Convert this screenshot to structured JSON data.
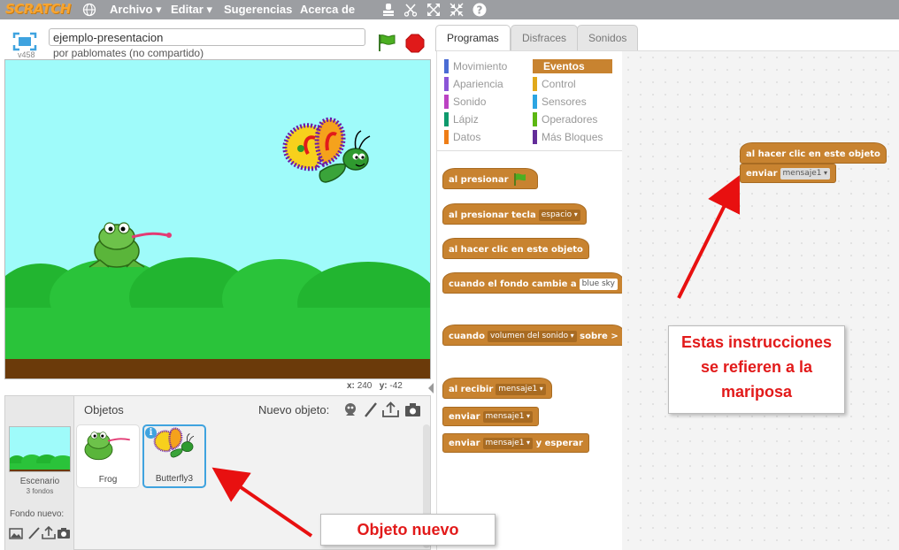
{
  "menubar": {
    "logo": "SCRATCH",
    "items": [
      "Archivo ▾",
      "Editar ▾",
      "Sugerencias",
      "Acerca de"
    ]
  },
  "stage_header": {
    "version": "v458",
    "project_title": "ejemplo-presentacion",
    "author": "por pablomates (no compartido)"
  },
  "stage": {
    "coords_x_label": "x:",
    "coords_x": "240",
    "coords_y_label": "y:",
    "coords_y": "-42"
  },
  "sprites": {
    "objects_label": "Objetos",
    "new_sprite_label": "Nuevo objeto:",
    "stage_label": "Escenario",
    "stage_backdrops": "3 fondos",
    "new_backdrop_label": "Fondo nuevo:",
    "items": [
      {
        "name": "Frog"
      },
      {
        "name": "Butterfly3"
      }
    ]
  },
  "tabs": [
    "Programas",
    "Disfraces",
    "Sonidos"
  ],
  "categories": [
    {
      "label": "Movimiento",
      "color": "#4a6cd4"
    },
    {
      "label": "Apariencia",
      "color": "#8a55d7"
    },
    {
      "label": "Sonido",
      "color": "#bb42c3"
    },
    {
      "label": "Lápiz",
      "color": "#0e9a6c"
    },
    {
      "label": "Datos",
      "color": "#ee7d16"
    },
    {
      "label": "Eventos",
      "color": "#c88330"
    },
    {
      "label": "Control",
      "color": "#e1a91a"
    },
    {
      "label": "Sensores",
      "color": "#2ca5e2"
    },
    {
      "label": "Operadores",
      "color": "#5cb712"
    },
    {
      "label": "Más Bloques",
      "color": "#632d99"
    }
  ],
  "blocks": {
    "flag": "al presionar",
    "key": "al presionar tecla",
    "key_opt": "espacio",
    "click": "al hacer clic en este objeto",
    "backdrop": "cuando el fondo cambie a",
    "backdrop_opt": "blue sky",
    "when": "cuando",
    "when_opt": "volumen del sonido",
    "when_gt": "sobre >",
    "receive": "al recibir",
    "receive_opt": "mensaje1",
    "broadcast": "enviar",
    "broadcast_opt": "mensaje1",
    "broadcast_wait": "enviar",
    "broadcast_wait_opt": "mensaje1",
    "broadcast_wait_tail": "y esperar"
  },
  "script": {
    "hat": "al hacer clic en este objeto",
    "cmd": "enviar",
    "cmd_opt": "mensaje1"
  },
  "callouts": {
    "instructions": "Estas instrucciones se refieren a la mariposa",
    "new_object": "Objeto nuevo"
  },
  "colors": {
    "events": "#c88330",
    "callout_text": "#e21a1a",
    "selection": "#3fa3df"
  }
}
